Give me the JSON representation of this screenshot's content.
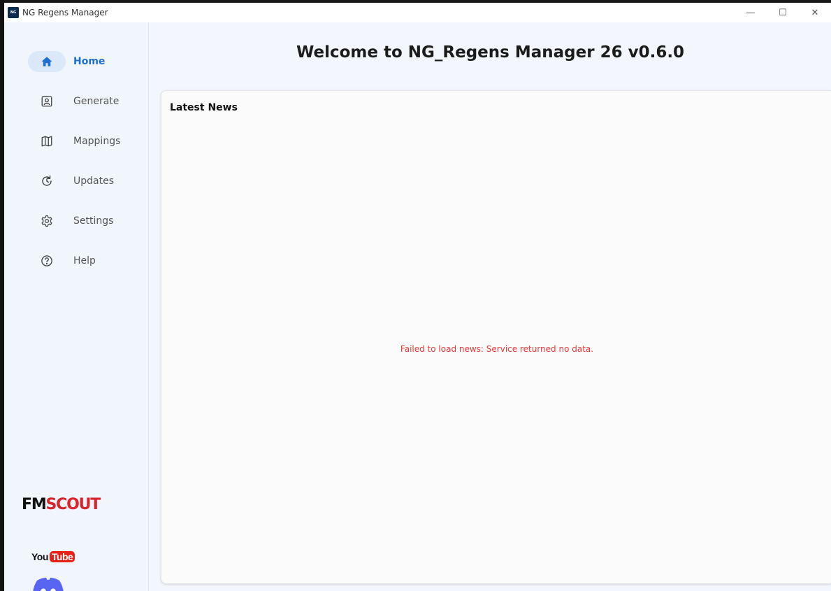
{
  "window": {
    "title": "NG Regens Manager",
    "icon_text": "NG",
    "minimize_glyph": "—",
    "maximize_glyph": "☐",
    "close_glyph": "✕"
  },
  "sidebar": {
    "items": [
      {
        "label": "Home",
        "icon": "home-icon",
        "active": true
      },
      {
        "label": "Generate",
        "icon": "id-card-icon",
        "active": false
      },
      {
        "label": "Mappings",
        "icon": "map-icon",
        "active": false
      },
      {
        "label": "Updates",
        "icon": "refresh-icon",
        "active": false
      },
      {
        "label": "Settings",
        "icon": "gear-icon",
        "active": false
      },
      {
        "label": "Help",
        "icon": "help-circle-icon",
        "active": false
      }
    ],
    "brand": {
      "fm": "FM",
      "scout": "SCOUT"
    },
    "youtube": {
      "you": "You",
      "tube": "Tube"
    },
    "discord": {
      "icon": "discord-icon"
    }
  },
  "main": {
    "title": "Welcome to NG_Regens Manager 26 v0.6.0",
    "news": {
      "title": "Latest News",
      "error": "Failed to load news: Service returned no data."
    }
  },
  "colors": {
    "accent": "#1f6fd0",
    "active_pill": "#dbe8f8",
    "error": "#e53935",
    "sidebar_bg": "#f1f5fc"
  }
}
